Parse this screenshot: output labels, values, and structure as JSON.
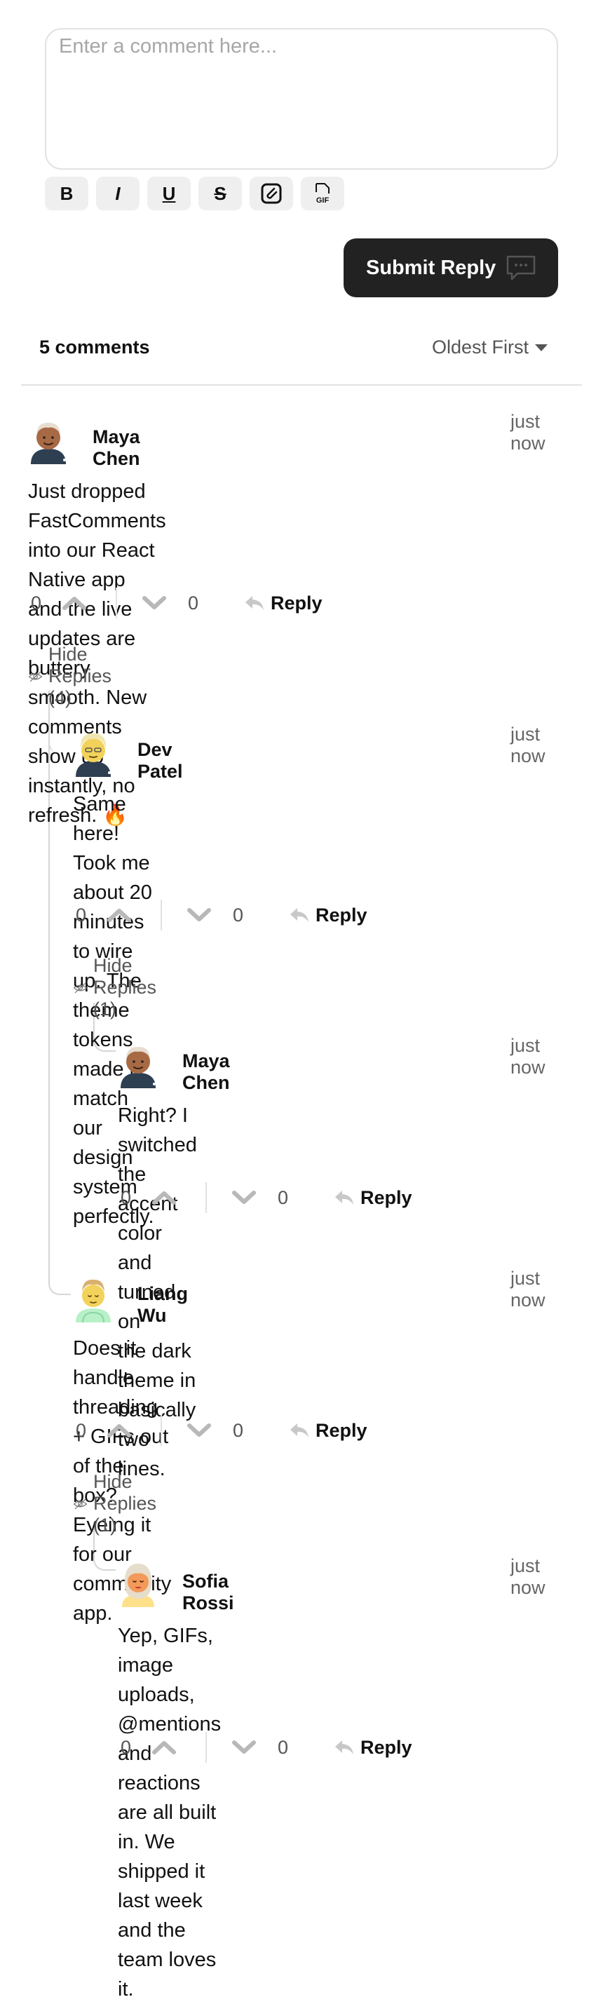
{
  "composer": {
    "placeholder": "Enter a comment here...",
    "toolbar": {
      "bold": "B",
      "italic": "I",
      "underline": "U",
      "strike": "S",
      "gif": "GIF"
    },
    "submit_label": "Submit Reply"
  },
  "list": {
    "count_label": "5 comments",
    "sort_label": "Oldest First"
  },
  "comments": [
    {
      "author": "Maya Chen",
      "time": "just now",
      "line1": "Just dropped FastComments into our React Native app",
      "line2": "and the live updates are buttery smooth. New comments",
      "line3": "show up instantly, no refresh. 🔥",
      "up": "0",
      "down": "0",
      "reply": "Reply",
      "hide": "Hide Replies (4)"
    },
    {
      "author": "Dev Patel",
      "time": "just now",
      "line1": "Same here! Took me about 20 minutes to wire up. The",
      "line2": "theme tokens made it match our design system",
      "line3": "perfectly.",
      "up": "0",
      "down": "0",
      "reply": "Reply",
      "hide": "Hide Replies (1)"
    },
    {
      "author": "Maya Chen",
      "time": "just now",
      "line1": "Right? I switched the accent color and turned on",
      "line2": "the dark theme in basically two lines.",
      "up": "0",
      "down": "0",
      "reply": "Reply"
    },
    {
      "author": "Liang Wu",
      "time": "just now",
      "line1": "Does it handle threading + GIFs out of the box?",
      "line2": "Eyeing it for our community app.",
      "up": "0",
      "down": "0",
      "reply": "Reply",
      "hide": "Hide Replies (1)"
    },
    {
      "author": "Sofia Rossi",
      "time": "just now",
      "line1": "Yep, GIFs, image uploads, @mentions and",
      "line2": "reactions are all built in. We shipped it last week",
      "line3": "and the team loves it.",
      "up": "0",
      "down": "0",
      "reply": "Reply"
    }
  ],
  "icons": {
    "attach": "paperclip-icon",
    "gif": "gif-icon",
    "submit": "chat-bubble-icon",
    "sort": "caret-down-icon",
    "upvote": "chevron-up-icon",
    "downvote": "chevron-down-icon",
    "reply": "reply-arrow-icon",
    "hide": "eye-slash-icon"
  },
  "colors": {
    "button_dark": "#222222",
    "border": "#e2e2e2",
    "muted": "#555555"
  }
}
